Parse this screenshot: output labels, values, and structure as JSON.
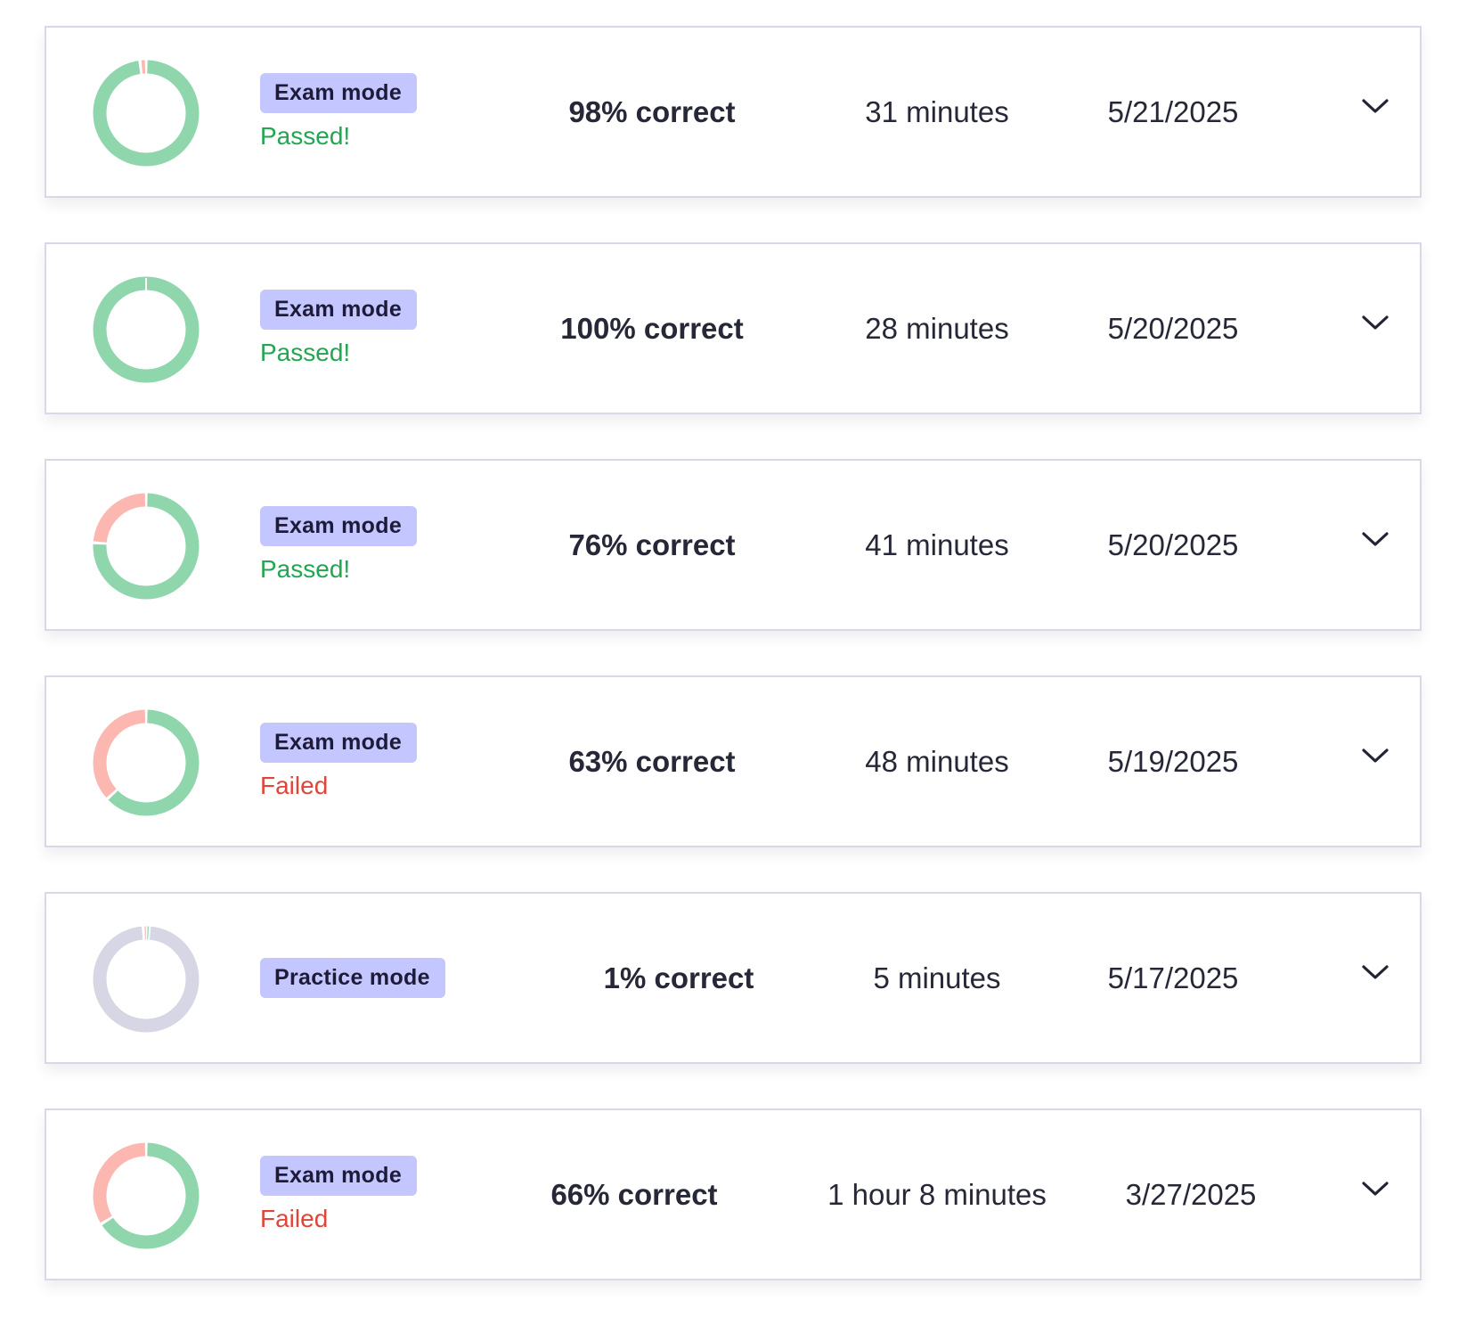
{
  "colors": {
    "correct": "#8fd6ac",
    "incorrect": "#fcb7b1",
    "unanswered": "#d6d6e4",
    "badge": "#c4c6ff",
    "passed": "#23a552",
    "failed": "#e0453a"
  },
  "attempts": [
    {
      "mode": "Exam mode",
      "status": "Passed!",
      "status_kind": "pass",
      "score": "98% correct",
      "duration": "31 minutes",
      "date": "5/21/2025",
      "correct": 0.98,
      "incorrect": 0.02,
      "unanswered": 0,
      "expand_icon": "chevron-down-icon"
    },
    {
      "mode": "Exam mode",
      "status": "Passed!",
      "status_kind": "pass",
      "score": "100% correct",
      "duration": "28 minutes",
      "date": "5/20/2025",
      "correct": 1.0,
      "incorrect": 0,
      "unanswered": 0,
      "expand_icon": "chevron-down-icon"
    },
    {
      "mode": "Exam mode",
      "status": "Passed!",
      "status_kind": "pass",
      "score": "76% correct",
      "duration": "41 minutes",
      "date": "5/20/2025",
      "correct": 0.76,
      "incorrect": 0.24,
      "unanswered": 0,
      "expand_icon": "chevron-down-icon"
    },
    {
      "mode": "Exam mode",
      "status": "Failed",
      "status_kind": "fail",
      "score": "63% correct",
      "duration": "48 minutes",
      "date": "5/19/2025",
      "correct": 0.63,
      "incorrect": 0.37,
      "unanswered": 0,
      "expand_icon": "chevron-down-icon"
    },
    {
      "mode": "Practice mode",
      "status": "",
      "status_kind": "none",
      "score": "1% correct",
      "duration": "5 minutes",
      "date": "5/17/2025",
      "correct": 0.01,
      "incorrect": 0.01,
      "unanswered": 0.98,
      "expand_icon": "chevron-down-icon"
    },
    {
      "mode": "Exam mode",
      "status": "Failed",
      "status_kind": "fail",
      "score": "66% correct",
      "duration": "1 hour 8 minutes",
      "date": "3/27/2025",
      "correct": 0.66,
      "incorrect": 0.34,
      "unanswered": 0,
      "expand_icon": "chevron-down-icon"
    }
  ]
}
